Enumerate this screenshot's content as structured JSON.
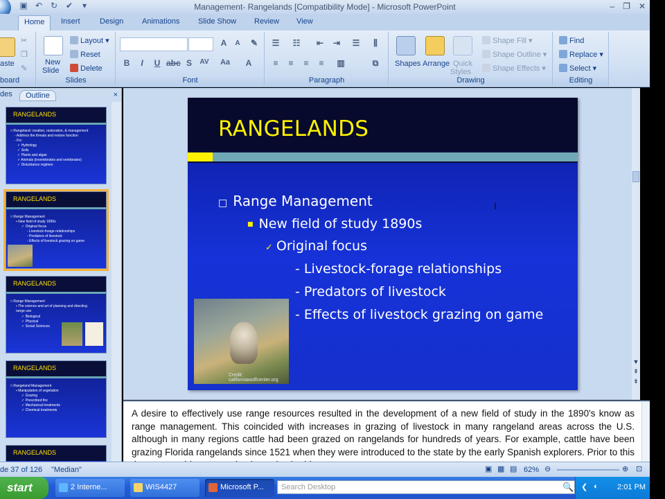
{
  "window": {
    "title": "Management- Rangelands [Compatibility Mode] - Microsoft PowerPoint"
  },
  "ribbon": {
    "tabs": [
      "Home",
      "Insert",
      "Design",
      "Animations",
      "Slide Show",
      "Review",
      "View"
    ],
    "clipboard": {
      "paste": "aste",
      "label": "board"
    },
    "slides": {
      "new_slide": "New",
      "new_slide2": "Slide",
      "layout": "Layout",
      "reset": "Reset",
      "delete": "Delete",
      "label": "Slides"
    },
    "font": {
      "label": "Font",
      "font_name": "",
      "font_size": ""
    },
    "paragraph": {
      "label": "Paragraph"
    },
    "drawing": {
      "shapes": "Shapes",
      "arrange": "Arrange",
      "quick": "Quick",
      "styles": "Styles",
      "shape_fill": "Shape Fill",
      "shape_outline": "Shape Outline",
      "shape_effects": "Shape Effects",
      "label": "Drawing"
    },
    "editing": {
      "find": "Find",
      "replace": "Replace",
      "select": "Select",
      "label": "Editing"
    }
  },
  "pane": {
    "tab_slides": "des",
    "tab_outline": "Outline",
    "close": "×",
    "thumbs": [
      {
        "title": "RANGELANDS",
        "lines": [
          "□ Rangeland: creation, restoration, & management",
          "- Address the threats and restore function",
          "- Fix:",
          "✓ Hydrology",
          "✓ Soils",
          "✓ Plants and algae",
          "✓ Animals (invertebrates and vertebrates)",
          "✓ Disturbance regimes"
        ]
      },
      {
        "title": "RANGELANDS",
        "lines": [
          "□ Range Management",
          "▪ New field of study 1890s",
          "✓ Original focus",
          "- Livestock-forage relationships",
          "- Predators of livestock",
          "- Effects of livestock grazing on game"
        ]
      },
      {
        "title": "RANGELANDS",
        "lines": [
          "□ Range Management",
          "▪ The science and art of planning and directing",
          "range use",
          "✓ Biological",
          "✓ Physical",
          "✓ Social Sciences"
        ]
      },
      {
        "title": "RANGELANDS",
        "lines": [
          "□ Rangeland Management",
          "▪ Manipulation of vegetation",
          "✓ Grazing",
          "✓ Prescribed fire",
          "✓ Mechanical treatments",
          "✓ Chemical treatments"
        ]
      },
      {
        "title": "RANGELANDS",
        "lines": []
      }
    ]
  },
  "slide": {
    "title": "RANGELANDS",
    "b1": "Range Management",
    "b2": "New field of study 1890s",
    "b3": "Original focus",
    "b4a": "- Livestock-forage relationships",
    "b4b": "- Predators of livestock",
    "b4c": "- Effects of livestock grazing on game",
    "credit": "Credit: californiawolfcenter.org"
  },
  "notes": {
    "text": "A desire to effectively use range resources resulted in the development of a new field of study in the 1890's know as range management.  This coincided with increases in grazing of livestock in many rangeland areas across the U.S. although in many regions cattle had been grazed on rangelands for hundreds of years.  For example, cattle have been grazing Florida rangelands since 1521 when they were introduced to the state by the early Spanish explorers.  Prior to this they were subject to grazing by native herbivores."
  },
  "status": {
    "slide_info": "de 37 of 126",
    "theme": "\"Median\"",
    "zoom": "62%"
  },
  "taskbar": {
    "start": "start",
    "tasks": [
      "2 Interne...",
      "WIS4427",
      "Microsoft P..."
    ],
    "search_placeholder": "Search Desktop",
    "clock": "2:01 PM"
  },
  "colors": {
    "slide_title": "#fff200",
    "slide_bg": "#1632d8",
    "accent_band": "#70a9b6",
    "selected_thumb": "#f6b33d"
  }
}
